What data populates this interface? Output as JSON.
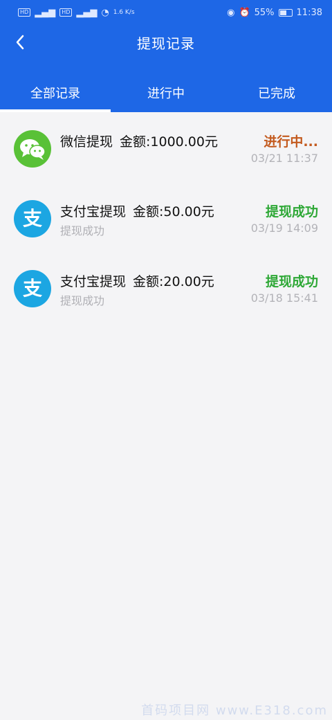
{
  "status_bar": {
    "hd1": "HD",
    "hd2": "HD",
    "net_speed": "1.6 K/s",
    "battery": "55%",
    "time": "11:38"
  },
  "header": {
    "title": "提现记录"
  },
  "tabs": [
    {
      "label": "全部记录",
      "active": true
    },
    {
      "label": "进行中",
      "active": false
    },
    {
      "label": "已完成",
      "active": false
    }
  ],
  "records": [
    {
      "channel": "微信提现",
      "amount": "金额:1000.00元",
      "note": "",
      "status": "进行中...",
      "time": "03/21 11:37",
      "icon": "wechat-icon"
    },
    {
      "channel": "支付宝提现",
      "amount": "金额:50.00元",
      "note": "提现成功",
      "status": "提现成功",
      "time": "03/19 14:09",
      "icon": "alipay-icon"
    },
    {
      "channel": "支付宝提现",
      "amount": "金额:20.00元",
      "note": "提现成功",
      "status": "提现成功",
      "time": "03/18 15:41",
      "icon": "alipay-icon"
    }
  ],
  "colors": {
    "header_bg": "#1e67e6",
    "pending": "#c35a1e",
    "success": "#2ea836",
    "wechat": "#59c137",
    "alipay": "#1ca6e2"
  },
  "watermark": "首码项目网 www.E318.com"
}
